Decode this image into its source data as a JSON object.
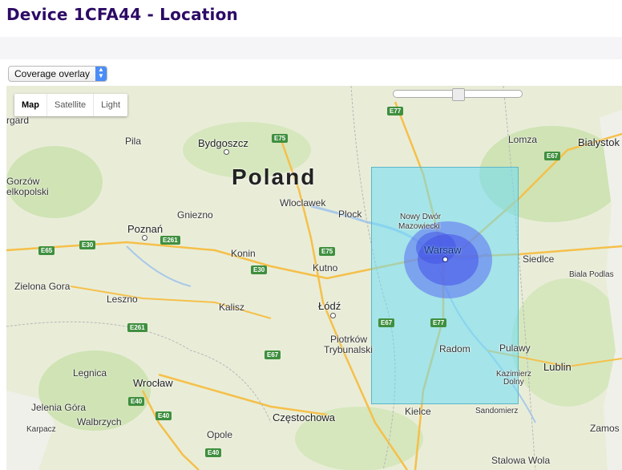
{
  "page": {
    "title": "Device 1CFA44 - Location"
  },
  "overlay_select": {
    "value": "Coverage overlay"
  },
  "map_type": {
    "map": "Map",
    "satellite": "Satellite",
    "light": "Light"
  },
  "slider": {
    "value": 0.5
  },
  "map": {
    "country": "Poland",
    "cities": {
      "bydgoszcz": "Bydgoszcz",
      "pila": "Pila",
      "gorzow": "Gorzów",
      "wielkopolski": "elkopolski",
      "gniezno": "Gniezno",
      "poznan": "Poznań",
      "wloclawek": "Wloclawek",
      "plock": "Plock",
      "konin": "Konin",
      "kutno": "Kutno",
      "zielona_gora": "Zielona Gora",
      "leszno": "Leszno",
      "kalisz": "Kalisz",
      "lodz": "Łódź",
      "piotrkow": "Piotrków",
      "trybunalski": "Trybunalski",
      "legnica": "Legnica",
      "wroclaw": "Wrocław",
      "jelenia_gora": "Jelenia Góra",
      "walbrzych": "Walbrzych",
      "karpacz": "Karpacz",
      "opole": "Opole",
      "czestochowa": "Częstochowa",
      "kielce": "Kielce",
      "radom": "Radom",
      "pulawy": "Pulawy",
      "kazimierz": "Kazimierz",
      "dolny": "Dolny",
      "lublin": "Lublin",
      "sandomierz": "Sandomierz",
      "stalowa_wola": "Stalowa Wola",
      "zamosc": "Zamos",
      "siedlce": "Siedlce",
      "biala_podlaska": "Biala Podlas",
      "lomza": "Lomza",
      "bialystok": "Bialystok",
      "nowy_dwor": "Nowy Dwór",
      "mazowiecki": "Mazowiecki",
      "warsaw": "Warsaw",
      "gard": "rgard"
    },
    "roads": {
      "e77_top": "E77",
      "e75_top": "E75",
      "e67_ne": "E67",
      "e30_w": "E30",
      "e65": "E65",
      "e261_a": "E261",
      "e75_mid": "E75",
      "e30_mid": "E30",
      "e261_b": "E261",
      "e67_mid": "E67",
      "e67_w": "E67",
      "e77_w": "E77",
      "e40_a": "E40",
      "e40_b": "E40",
      "e40_c": "E40"
    }
  }
}
